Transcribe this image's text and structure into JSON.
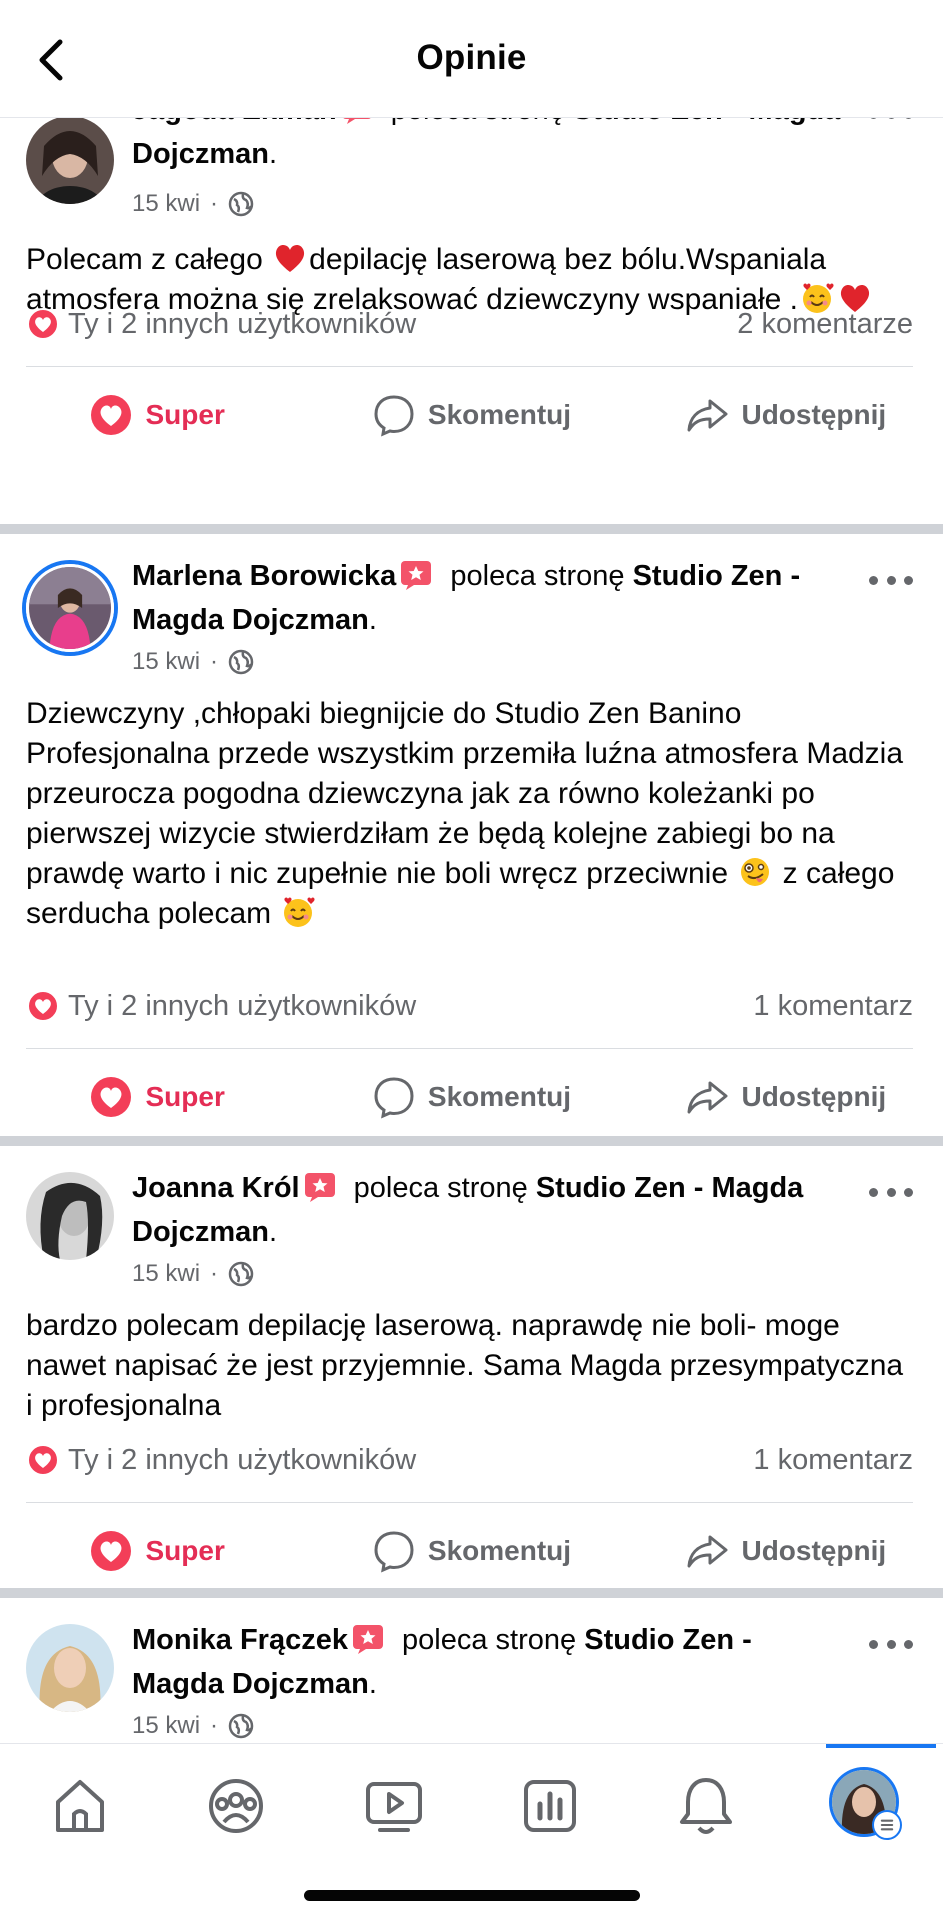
{
  "header": {
    "title": "Opinie",
    "back_icon": "chevron-left-icon"
  },
  "common": {
    "verb": "poleca stronę",
    "page": "Studio Zen - Magda Dojczman",
    "page_part1": "Studio Zen",
    "page_part2": "- Magda Dojczman",
    "page_part_a": "Studio Zen -",
    "page_part_b": "Magda Dojczman",
    "page_part_c": "Studio",
    "page_part_d": "Zen - Magda Dojczman",
    "date": "15 kwi",
    "dot": "·",
    "reactions_text": "Ty i 2 innych użytkowników",
    "action_super": "Super",
    "action_comment": "Skomentuj",
    "action_share": "Udostępnij"
  },
  "posts": [
    {
      "author": "Jagoda Ekman",
      "text_1": "Polecam  z całego",
      "text_2": "depilację laserową bez bólu.Wspaniala atmosfera można się zrelaksować dziewczyny wspaniałe .",
      "comments": "2 komentarze"
    },
    {
      "author": "Marlena Borowicka",
      "text_1": "Dziewczyny ,chłopaki  biegnijcie do Studio Zen Banino Profesjonalna  przede wszystkim przemiła luźna atmosfera Madzia przeurocza pogodna dziewczyna jak za równo koleżanki po pierwszej wizycie stwierdziłam że będą kolejne zabiegi bo na prawdę warto i nic zupełnie nie boli wręcz przeciwnie",
      "text_2": " z całego serducha polecam ",
      "comments": "1 komentarz"
    },
    {
      "author": "Joanna Król",
      "text_1": "bardzo polecam depilację laserową. naprawdę nie boli- moge nawet napisać że jest przyjemnie. Sama Magda przesympatyczna i profesjonalna",
      "comments": "1 komentarz"
    },
    {
      "author": "Monika Frączek"
    }
  ],
  "icons": {
    "recommend": "recommend-badge-icon",
    "privacy": "globe-icon",
    "more": "more-dots-icon",
    "love": "love-reaction-icon",
    "comment": "comment-bubble-icon",
    "share": "share-arrow-icon"
  },
  "nav": {
    "items": [
      "home-icon",
      "groups-icon",
      "video-icon",
      "insights-icon",
      "notifications-icon",
      "profile-menu-avatar"
    ]
  },
  "colors": {
    "accent_blue": "#1877f2",
    "love_red": "#e42d55",
    "secondary_text": "#65676b",
    "separator": "#cfd2d7"
  }
}
